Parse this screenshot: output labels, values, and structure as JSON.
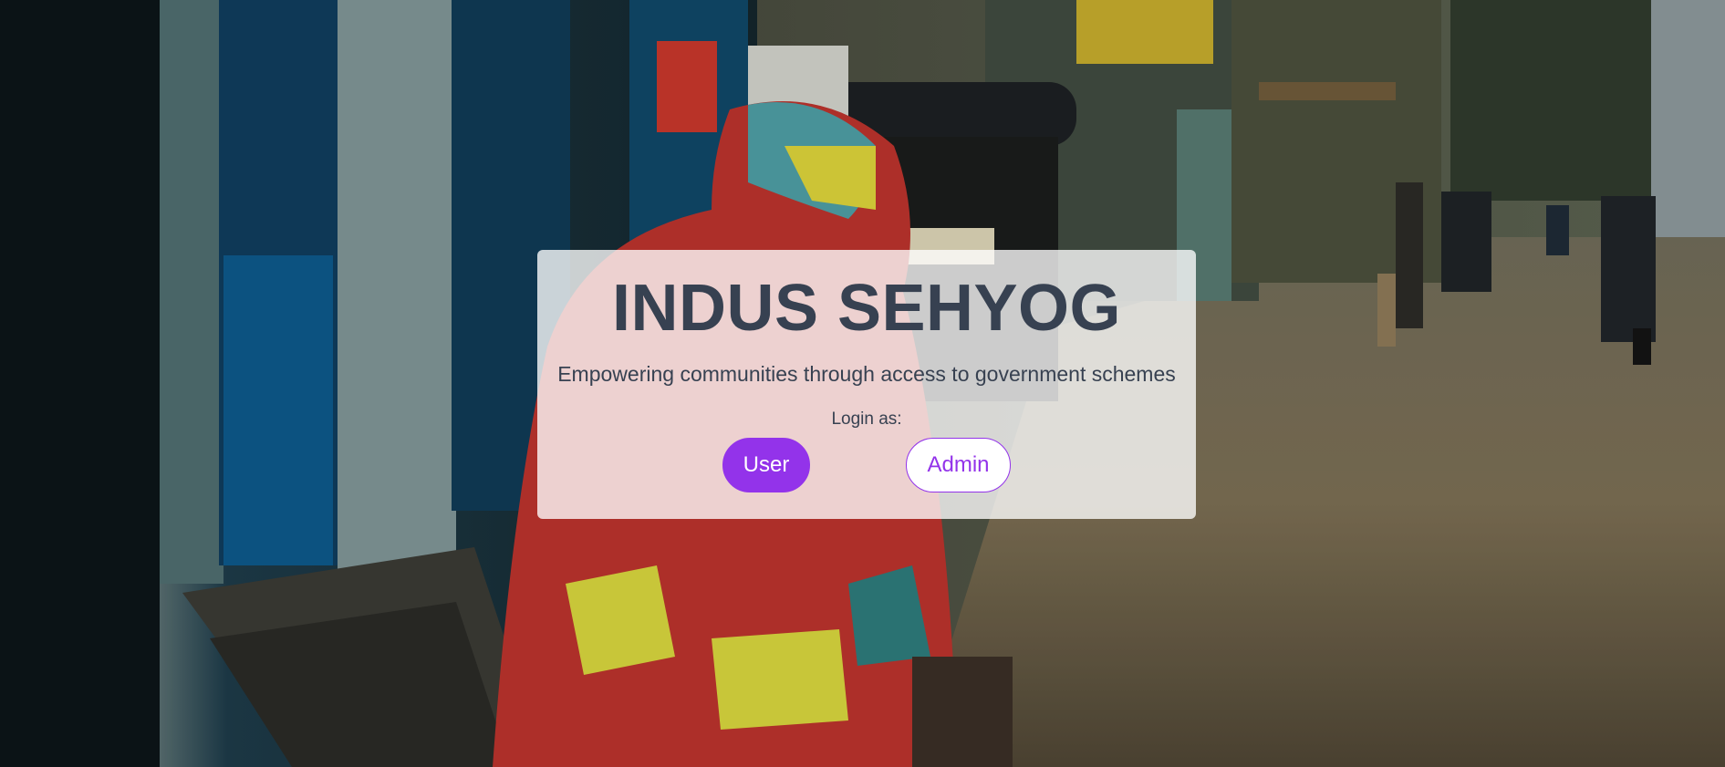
{
  "app": {
    "title": "INDUS SEHYOG",
    "tagline": "Empowering communities through access to government schemes"
  },
  "login": {
    "prompt": "Login as:",
    "user_label": "User",
    "admin_label": "Admin"
  },
  "colors": {
    "accent": "#9333ea",
    "text": "#374151",
    "card_bg": "rgba(255,255,255,0.78)"
  }
}
